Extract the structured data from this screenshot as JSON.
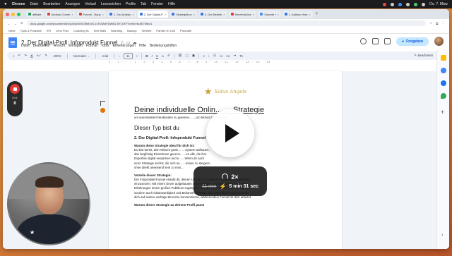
{
  "menubar": {
    "apple": "",
    "app": "Chrome",
    "items": [
      "Datei",
      "Bearbeiten",
      "Anzeigen",
      "Verlauf",
      "Lesezeichen",
      "Profile",
      "Tab",
      "Fenster",
      "Hilfe"
    ],
    "clock": "Do. 7. März"
  },
  "browser": {
    "tabs": [
      {
        "label": "affiliate",
        "icon": "doc-icon"
      },
      {
        "label": "Kanban Comm",
        "icon": "doc-icon"
      },
      {
        "label": "Funnel - Bauş",
        "icon": "doc-icon"
      },
      {
        "label": "1. Der Aufbau",
        "icon": "doc-icon"
      },
      {
        "label": "2. Der Digital-P",
        "icon": "doc-icon",
        "active": true
      },
      {
        "label": "Strategiebox",
        "icon": "doc-icon"
      },
      {
        "label": "4. Der Bestim",
        "icon": "doc-icon"
      },
      {
        "label": "Herzenskönn",
        "icon": "doc-icon"
      },
      {
        "label": "Experte f",
        "icon": "doc-icon"
      },
      {
        "label": "1. Aufbau Hera",
        "icon": "doc-icon"
      }
    ],
    "url": "docs.google.com/document/d/1spEszGMC09sf1xS-1vTsSAbFDW6U-6Yl-0XFYomIvVkckE7ble/c1",
    "bookmarks": [
      "Neue",
      "Tools & Produkte",
      "KPI",
      "Jens Post",
      "Coaching IA",
      "Soft Skills",
      "Branding",
      "Backup",
      "Vertrieb",
      "Partner-KI Link",
      "Produkte"
    ]
  },
  "docs": {
    "title": "2. Der Digital-Profi: Infoprodukt Funnel",
    "menu": [
      "Datei",
      "Bearbeiten",
      "Ansicht",
      "Einfügen",
      "Format",
      "Tools",
      "Erweiterungen",
      "Hilfe",
      "Bedienungshilfen"
    ],
    "share_label": "Freigeben",
    "toolbar": {
      "zoom": "100%",
      "style": "Normaler ...",
      "font": "Arial",
      "size": "11",
      "mode": "Bearbeiten"
    },
    "ruler": "2 · · · 1 · · · ·  · · · 1 · · · 2 · · · 3 · · · 4 · · · 5 · · · 6 · · · 7 · · · 8 · · · 9 · · · 10 · · · 11 · · · 12 · · · 13 · · · 14 · · · 15"
  },
  "content": {
    "logo_text": "Salus Angels",
    "heading1": "Deine individuelle Onlin... ...-Strategie",
    "subtitle": "um automatisiert Neukunden zu gewinne...                                    ... pro Monat zu erreichen",
    "heading2": "Dieser Typ bist du",
    "heading3": "2. Der Digital-Profi: Infoprodukt Funnel",
    "heading4a": "Warum diese Strategie ideal für dich ist:",
    "para1": [
      "Du bist bereit, dein Wissen gezie...                              ... System aufbauen,",
      "das langfristig Einnahmen generie...                              ...en alle, die ihre",
      "Expertise digital verpacken und e...                              ...Wenn du nach",
      "einer Strategie suchst, die sich au...                            ...mmen zu steigern,",
      "ohne direkt anwesend sein zu müs..."
    ],
    "heading4b": "Vorteile dieser Strategie:",
    "para2": [
      "Der Infoprodukt-Funnel erlaubt dir, deinen Umsatz zu skalieren und deine Zeit effizient",
      "einzusetzen. Mit einem clever aufgebauten System kannst du dein Wissen und deine",
      "Erfahrungen einem großen Publikum zugänglich machen, was dir nicht nur Einnahmen,",
      "sondern auch Glaubwürdigkeit und Bekanntheit bringt. Du Automatisierung kannst du",
      "dich auf andere wichtige Bereiche konzentrieren, während dein Funnel für dich arbeitet."
    ],
    "heading4c": "Warum dieser Strategie zu deinem Profil passt"
  },
  "recorder": {
    "time": "0:01",
    "pause": "II"
  },
  "video_overlay": {
    "speed": "2×",
    "old_time": "11 min",
    "new_time": "5 min 31 sec"
  }
}
